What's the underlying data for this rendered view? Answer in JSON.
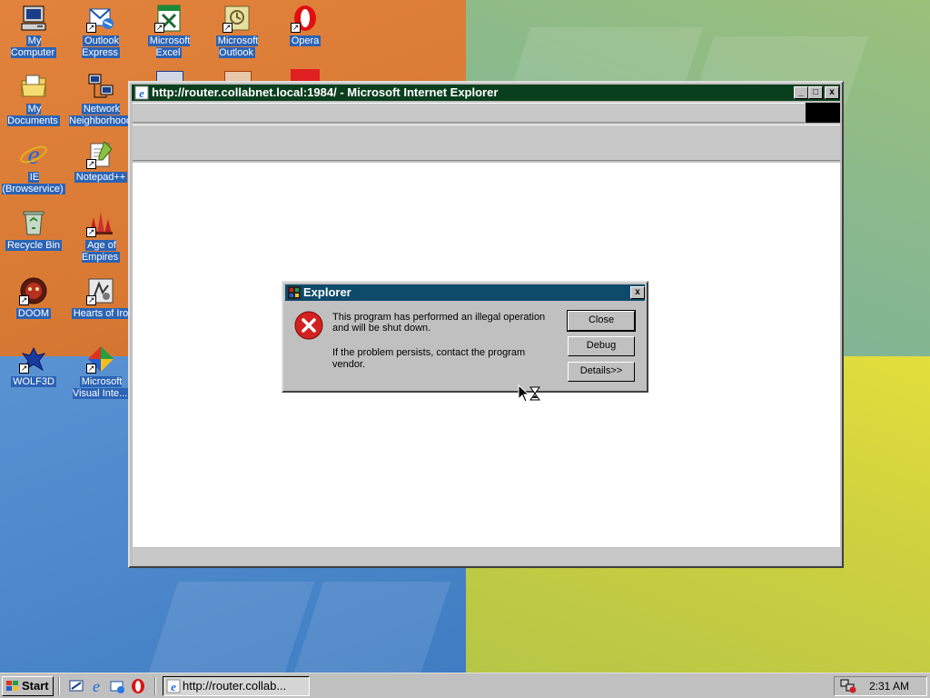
{
  "desktop": {
    "icons": [
      {
        "label": "My Computer",
        "icon": "my-computer-icon"
      },
      {
        "label": "Outlook Express",
        "icon": "outlook-express-icon"
      },
      {
        "label": "Microsoft Excel",
        "icon": "excel-icon"
      },
      {
        "label": "Microsoft Outlook",
        "icon": "outlook-icon"
      },
      {
        "label": "Opera",
        "icon": "opera-icon"
      },
      {
        "label": "My Documents",
        "icon": "my-documents-icon"
      },
      {
        "label": "Network Neighborhood",
        "icon": "network-neighborhood-icon"
      },
      {
        "label": "IE (Browservice)",
        "icon": "internet-explorer-icon"
      },
      {
        "label": "Notepad++",
        "icon": "notepad-plus-plus-icon"
      },
      {
        "label": "Recycle Bin",
        "icon": "recycle-bin-icon"
      },
      {
        "label": "Age of Empires",
        "icon": "age-of-empires-icon"
      },
      {
        "label": "DOOM",
        "icon": "doom-icon"
      },
      {
        "label": "Hearts of Iro",
        "icon": "hearts-of-iron-icon"
      },
      {
        "label": "WOLF3D",
        "icon": "wolf3d-icon"
      },
      {
        "label": "Microsoft Visual Inte...",
        "icon": "visual-interdev-icon"
      }
    ]
  },
  "ie_window": {
    "title": "http://router.collabnet.local:1984/ - Microsoft Internet Explorer",
    "minimize_label": "_",
    "maximize_label": "□",
    "close_label": "x"
  },
  "error_dialog": {
    "title": "Explorer",
    "close_label": "x",
    "message_line1": "This program has performed an illegal operation",
    "message_line2": "and will be shut down.",
    "message_line3": "If the problem persists, contact the program",
    "message_line4": "vendor.",
    "buttons": {
      "close": "Close",
      "debug": "Debug",
      "details": "Details>>"
    }
  },
  "taskbar": {
    "start_label": "Start",
    "task_ie_label": "http://router.collab...",
    "clock": "2:31 AM"
  },
  "colors": {
    "ie_titlebar": "#0a3f1e",
    "dialog_titlebar": "#0e4a6a",
    "error_icon": "#d42020"
  }
}
